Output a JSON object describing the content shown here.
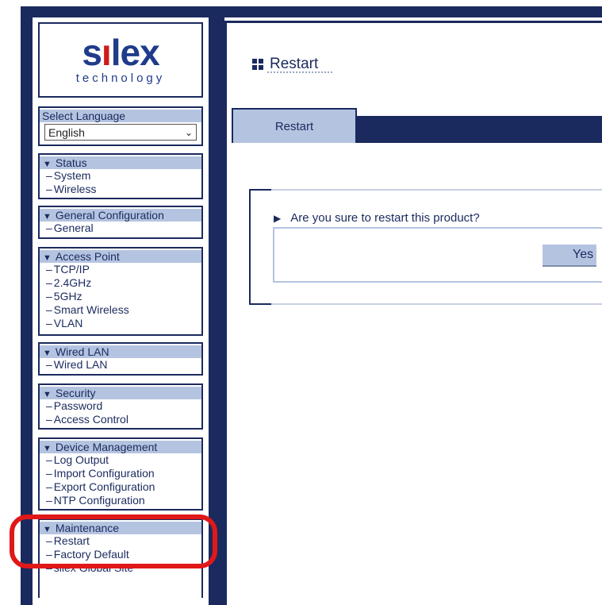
{
  "logo": {
    "word_prefix": "s",
    "word_i": "ı",
    "word_suffix": "lex",
    "subtitle": "technology"
  },
  "language": {
    "label": "Select Language",
    "selected": "English"
  },
  "sidebar": {
    "status": {
      "header": "Status",
      "items": [
        "System",
        "Wireless"
      ]
    },
    "general": {
      "header": "General Configuration",
      "items": [
        "General"
      ]
    },
    "access": {
      "header": "Access Point",
      "items": [
        "TCP/IP",
        "2.4GHz",
        "5GHz",
        "Smart Wireless",
        "VLAN"
      ]
    },
    "wired": {
      "header": "Wired LAN",
      "items": [
        "Wired LAN"
      ]
    },
    "security": {
      "header": "Security",
      "items": [
        "Password",
        "Access Control"
      ]
    },
    "device": {
      "header": "Device Management",
      "items": [
        "Log Output",
        "Import Configuration",
        "Export Configuration",
        "NTP Configuration"
      ]
    },
    "maint": {
      "header": "Maintenance",
      "items": [
        "Restart",
        "Factory Default",
        "silex Global Site"
      ]
    }
  },
  "main": {
    "title": "Restart",
    "tab": "Restart",
    "question": "Are you sure to restart this product?",
    "yes_label": "Yes"
  },
  "colors": {
    "navy": "#1b2a5e",
    "light_blue": "#b4c4e0",
    "highlight_red": "#e01818"
  }
}
